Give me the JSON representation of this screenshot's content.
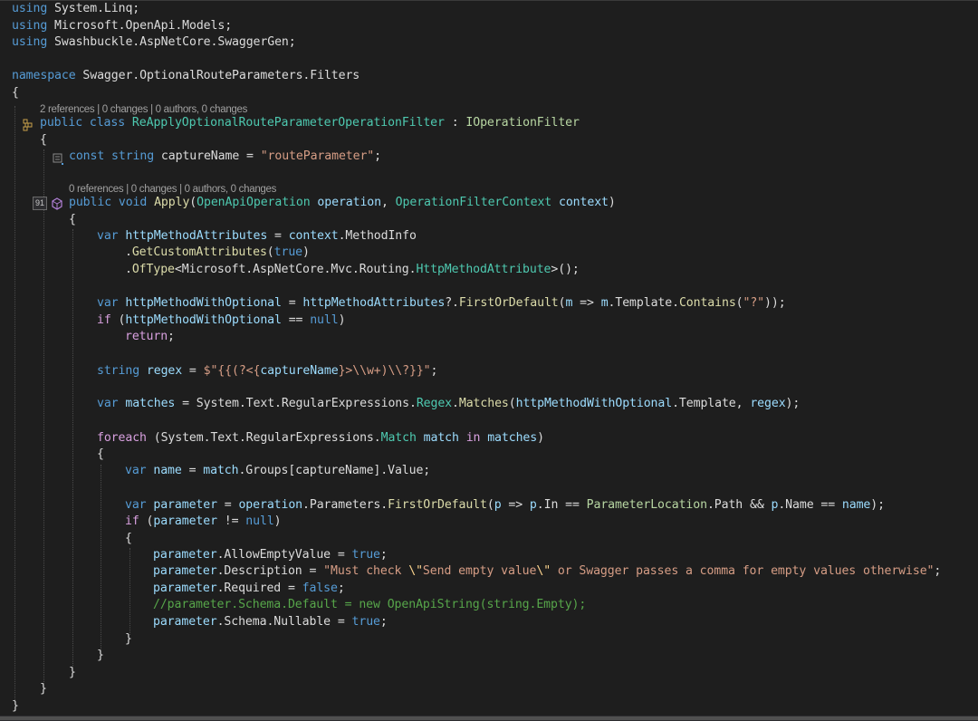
{
  "editor": {
    "usings": [
      {
        "kw": "using",
        "ns": "System.Linq;"
      },
      {
        "kw": "using",
        "ns": "Microsoft.OpenApi.Models;"
      },
      {
        "kw": "using",
        "ns": "Swashbuckle.AspNetCore.SwaggerGen;"
      }
    ],
    "namespace_kw": "namespace",
    "namespace_name": "Swagger.OptionalRouteParameters.Filters",
    "brace_open": "{",
    "brace_close": "}",
    "class_lens": "2 references | 0 changes | 0 authors, 0 changes",
    "class_decl": {
      "modifiers": "public class",
      "name": "ReApplyOptionalRouteParameterOperationFilter",
      "colon": " : ",
      "base": "IOperationFilter"
    },
    "const_line": {
      "keywords": "const string",
      "name": "captureName",
      "eq": " = ",
      "value": "\"routeParameter\"",
      "semi": ";"
    },
    "method_lens": "0 references | 0 changes | 0 authors, 0 changes",
    "method_line_number": "91",
    "method_decl": {
      "modifiers": "public void",
      "name": "Apply",
      "open": "(",
      "param1_type": "OpenApiOperation",
      "param1_name": "operation",
      "comma": ", ",
      "param2_type": "OperationFilterContext",
      "param2_name": "context",
      "close": ")"
    },
    "code": {
      "l1_var": "var",
      "l1_name": "httpMethodAttributes",
      "l1_eq": " = ",
      "l1_ctx": "context",
      "l1_rest": ".MethodInfo",
      "l2_dot": ".",
      "l2_method": "GetCustomAttributes",
      "l2_open": "(",
      "l2_true": "true",
      "l2_close": ")",
      "l3_dot": ".",
      "l3_method": "OfType",
      "l3_generic": "<Microsoft.AspNetCore.Mvc.Routing.",
      "l3_type": "HttpMethodAttribute",
      "l3_end": ">();",
      "l4_var": "var",
      "l4_name": "httpMethodWithOptional",
      "l4_eq": " = ",
      "l4_src": "httpMethodAttributes",
      "l4_op": "?.",
      "l4_method": "FirstOrDefault",
      "l4_open": "(",
      "l4_m": "m",
      "l4_arrow": " => ",
      "l4_m2": "m",
      "l4_tmpl": ".Template.",
      "l4_contains": "Contains",
      "l4_open2": "(",
      "l4_str": "\"?\"",
      "l4_end": "));",
      "l5_if": "if",
      "l5_open": " (",
      "l5_name": "httpMethodWithOptional",
      "l5_eq": " == ",
      "l5_null": "null",
      "l5_close": ")",
      "l6_return": "return",
      "l6_semi": ";",
      "l7_type": "string",
      "l7_name": "regex",
      "l7_eq": " = ",
      "l7_str_a": "$\"{{(?<{",
      "l7_interp": "captureName",
      "l7_str_b": "}>\\\\w+)\\\\?}}\"",
      "l7_semi": ";",
      "l8_var": "var",
      "l8_name": "matches",
      "l8_eq": " = ",
      "l8_ns": "System.Text.RegularExpressions.",
      "l8_type": "Regex",
      "l8_dot": ".",
      "l8_method": "Matches",
      "l8_open": "(",
      "l8_arg1": "httpMethodWithOptional",
      "l8_tmpl": ".Template, ",
      "l8_arg2": "regex",
      "l8_end": ");",
      "l9_foreach": "foreach",
      "l9_open": " (",
      "l9_ns": "System.Text.RegularExpressions.",
      "l9_type": "Match",
      "l9_sp": " ",
      "l9_name": "match",
      "l9_in": " in ",
      "l9_coll": "matches",
      "l9_close": ")",
      "l10_var": "var",
      "l10_name": "name",
      "l10_eq": " = ",
      "l10_src": "match",
      "l10_rest": ".Groups[captureName].Value;",
      "l11_var": "var",
      "l11_name": "parameter",
      "l11_eq": " = ",
      "l11_src": "operation",
      "l11_mid": ".Parameters.",
      "l11_method": "FirstOrDefault",
      "l11_open": "(",
      "l11_p": "p",
      "l11_arrow": " => ",
      "l11_p2": "p",
      "l11_in": ".In == ",
      "l11_enum": "ParameterLocation",
      "l11_path": ".Path && ",
      "l11_p3": "p",
      "l11_nm": ".Name == ",
      "l11_name2": "name",
      "l11_end": ");",
      "l12_if": "if",
      "l12_open": " (",
      "l12_name": "parameter",
      "l12_neq": " != ",
      "l12_null": "null",
      "l12_close": ")",
      "l13_obj": "parameter",
      "l13_prop": ".AllowEmptyValue = ",
      "l13_val": "true",
      "l13_semi": ";",
      "l14_obj": "parameter",
      "l14_prop": ".Description = ",
      "l14_str_a": "\"Must check ",
      "l14_esc1": "\\\"",
      "l14_str_b": "Send empty value",
      "l14_esc2": "\\\"",
      "l14_str_c": " or Swagger passes a comma for empty values otherwise\"",
      "l14_semi": ";",
      "l15_obj": "parameter",
      "l15_prop": ".Required = ",
      "l15_val": "false",
      "l15_semi": ";",
      "l16_comment": "//parameter.Schema.Default = new OpenApiString(string.Empty);",
      "l17_obj": "parameter",
      "l17_prop": ".Schema.Nullable = ",
      "l17_val": "true",
      "l17_semi": ";"
    }
  }
}
